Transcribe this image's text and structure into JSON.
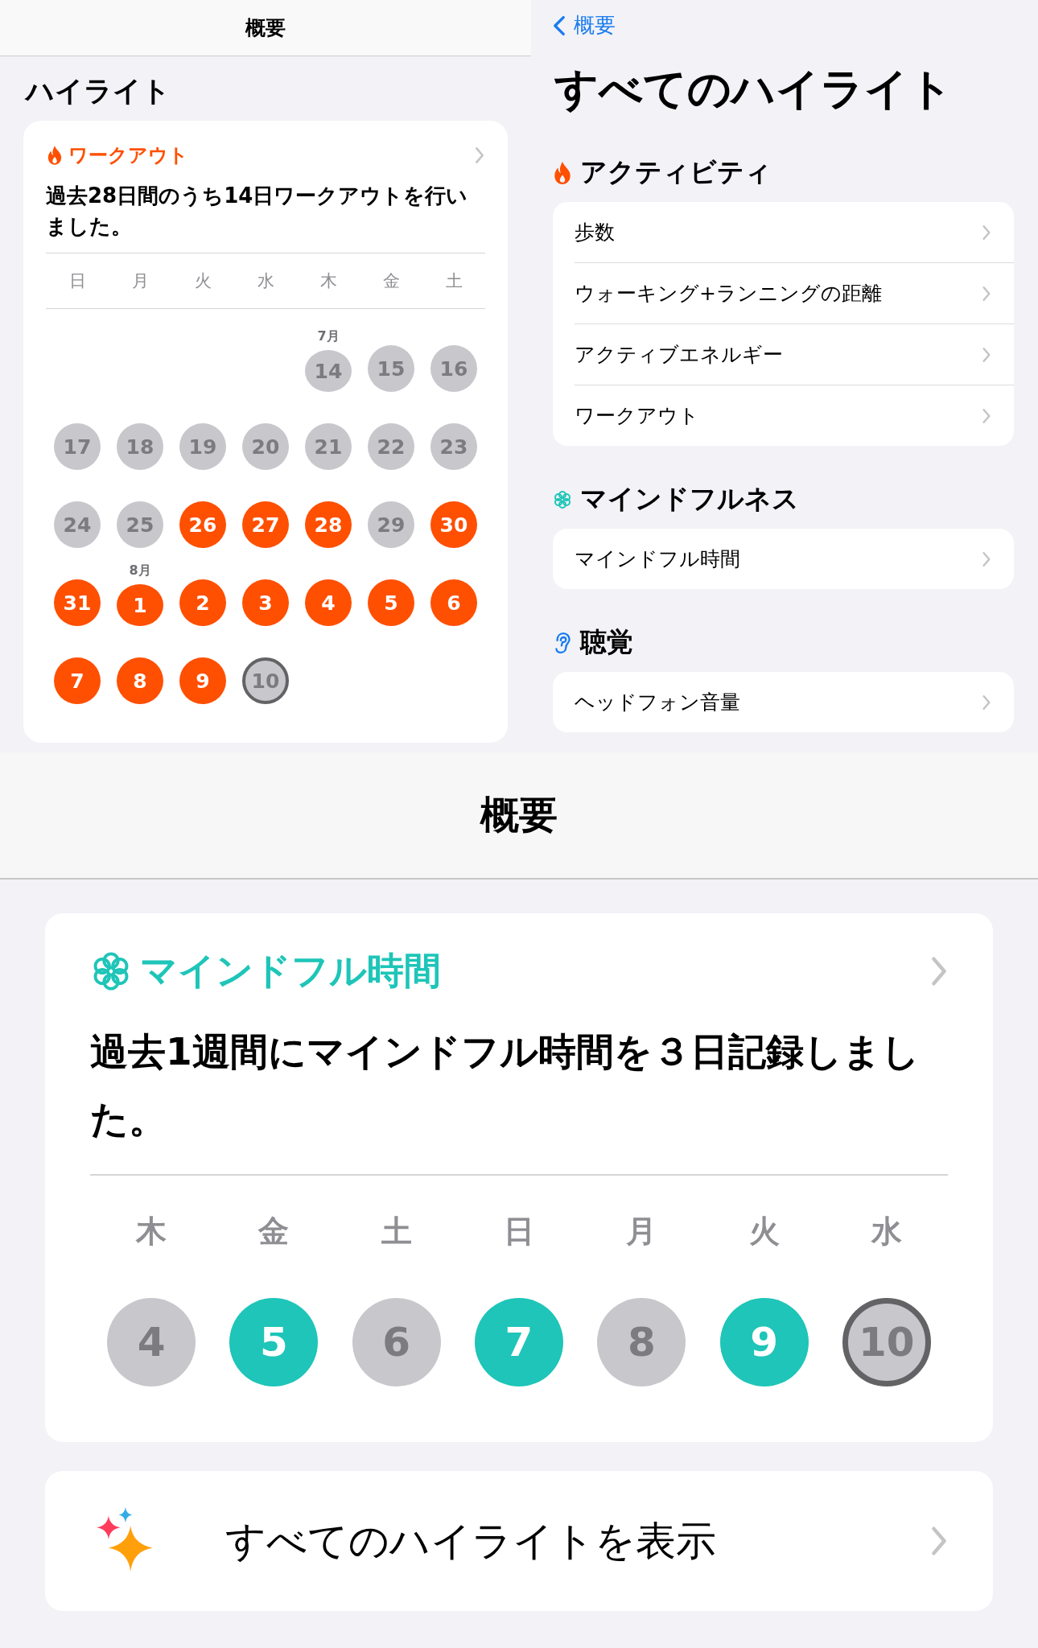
{
  "left_panel": {
    "nav_title": "概要",
    "heading": "ハイライト",
    "card": {
      "kind": "workout",
      "category": "ワークアウト",
      "summary": "過去28日間のうち14日ワークアウトを行いました。",
      "weekdays": [
        "日",
        "月",
        "火",
        "水",
        "木",
        "金",
        "土"
      ],
      "days": [
        {
          "kind": "blank"
        },
        {
          "kind": "blank"
        },
        {
          "kind": "blank"
        },
        {
          "kind": "blank"
        },
        {
          "kind": "missed",
          "label": "14",
          "month": "7月"
        },
        {
          "kind": "missed",
          "label": "15"
        },
        {
          "kind": "missed",
          "label": "16"
        },
        {
          "kind": "missed",
          "label": "17"
        },
        {
          "kind": "missed",
          "label": "18"
        },
        {
          "kind": "missed",
          "label": "19"
        },
        {
          "kind": "missed",
          "label": "20"
        },
        {
          "kind": "missed",
          "label": "21"
        },
        {
          "kind": "missed",
          "label": "22"
        },
        {
          "kind": "missed",
          "label": "23"
        },
        {
          "kind": "missed",
          "label": "24"
        },
        {
          "kind": "missed",
          "label": "25"
        },
        {
          "kind": "done",
          "label": "26"
        },
        {
          "kind": "done",
          "label": "27"
        },
        {
          "kind": "done",
          "label": "28"
        },
        {
          "kind": "missed",
          "label": "29"
        },
        {
          "kind": "done",
          "label": "30"
        },
        {
          "kind": "done",
          "label": "31"
        },
        {
          "kind": "done",
          "label": "1",
          "month": "8月"
        },
        {
          "kind": "done",
          "label": "2"
        },
        {
          "kind": "done",
          "label": "3"
        },
        {
          "kind": "done",
          "label": "4"
        },
        {
          "kind": "done",
          "label": "5"
        },
        {
          "kind": "done",
          "label": "6"
        },
        {
          "kind": "done",
          "label": "7"
        },
        {
          "kind": "done",
          "label": "8"
        },
        {
          "kind": "done",
          "label": "9"
        },
        {
          "kind": "today",
          "label": "10"
        }
      ]
    }
  },
  "right_panel": {
    "back": "概要",
    "title": "すべてのハイライト",
    "sections": [
      {
        "kind": "activity",
        "heading": "アクティビティ",
        "items": [
          "歩数",
          "ウォーキング+ランニングの距離",
          "アクティブエネルギー",
          "ワークアウト"
        ]
      },
      {
        "kind": "mindfulness",
        "heading": "マインドフルネス",
        "items": [
          "マインドフル時間"
        ]
      },
      {
        "kind": "hearing",
        "heading": "聴覚",
        "items": [
          "ヘッドフォン音量"
        ]
      }
    ]
  },
  "bottom_panel": {
    "nav_title": "概要",
    "card": {
      "kind": "mindfulness",
      "category": "マインドフル時間",
      "summary": "過去1週間にマインドフル時間を３日記録しました。",
      "weekdays": [
        "木",
        "金",
        "土",
        "日",
        "月",
        "火",
        "水"
      ],
      "days": [
        {
          "kind": "missed",
          "label": "4"
        },
        {
          "kind": "done",
          "label": "5"
        },
        {
          "kind": "missed",
          "label": "6"
        },
        {
          "kind": "done",
          "label": "7"
        },
        {
          "kind": "missed",
          "label": "8"
        },
        {
          "kind": "done",
          "label": "9"
        },
        {
          "kind": "today",
          "label": "10"
        }
      ]
    },
    "show_all": "すべてのハイライトを表示"
  }
}
